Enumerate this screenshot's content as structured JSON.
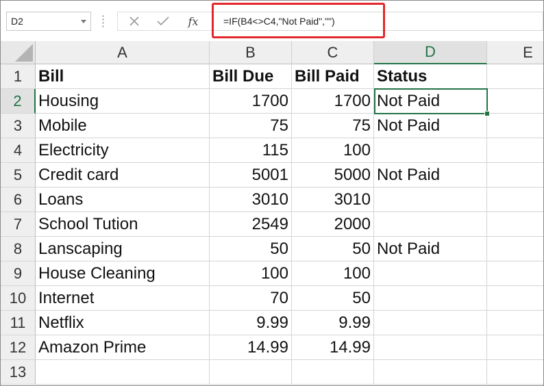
{
  "name_box": {
    "value": "D2"
  },
  "formula_bar": {
    "cancel_icon": "close-icon",
    "enter_icon": "check-icon",
    "fx_label": "fx",
    "formula": "=IF(B4<>C4,\"Not Paid\",\"\")",
    "highlight_color": "#e3262b"
  },
  "colors": {
    "accent": "#217346",
    "highlight": "#e3262b"
  },
  "columns": [
    "A",
    "B",
    "C",
    "D",
    "E"
  ],
  "active_cell": "D2",
  "rows": [
    {
      "num": "1",
      "cells": [
        "Bill",
        "Bill Due",
        "Bill Paid",
        "Status",
        ""
      ]
    },
    {
      "num": "2",
      "cells": [
        "Housing",
        "1700",
        "1700",
        "Not Paid",
        ""
      ]
    },
    {
      "num": "3",
      "cells": [
        "Mobile",
        "75",
        "75",
        "Not Paid",
        ""
      ]
    },
    {
      "num": "4",
      "cells": [
        "Electricity",
        "115",
        "100",
        "",
        ""
      ]
    },
    {
      "num": "5",
      "cells": [
        "Credit card",
        "5001",
        "5000",
        "Not Paid",
        ""
      ]
    },
    {
      "num": "6",
      "cells": [
        "Loans",
        "3010",
        "3010",
        "",
        ""
      ]
    },
    {
      "num": "7",
      "cells": [
        "School Tution",
        "2549",
        "2000",
        "",
        ""
      ]
    },
    {
      "num": "8",
      "cells": [
        "Lanscaping",
        "50",
        "50",
        "Not Paid",
        ""
      ]
    },
    {
      "num": "9",
      "cells": [
        "House Cleaning",
        "100",
        "100",
        "",
        ""
      ]
    },
    {
      "num": "10",
      "cells": [
        "Internet",
        "70",
        "50",
        "",
        ""
      ]
    },
    {
      "num": "11",
      "cells": [
        "Netflix",
        "9.99",
        "9.99",
        "",
        ""
      ]
    },
    {
      "num": "12",
      "cells": [
        "Amazon Prime",
        "14.99",
        "14.99",
        "",
        ""
      ]
    },
    {
      "num": "13",
      "cells": [
        "",
        "",
        "",
        "",
        ""
      ]
    }
  ]
}
